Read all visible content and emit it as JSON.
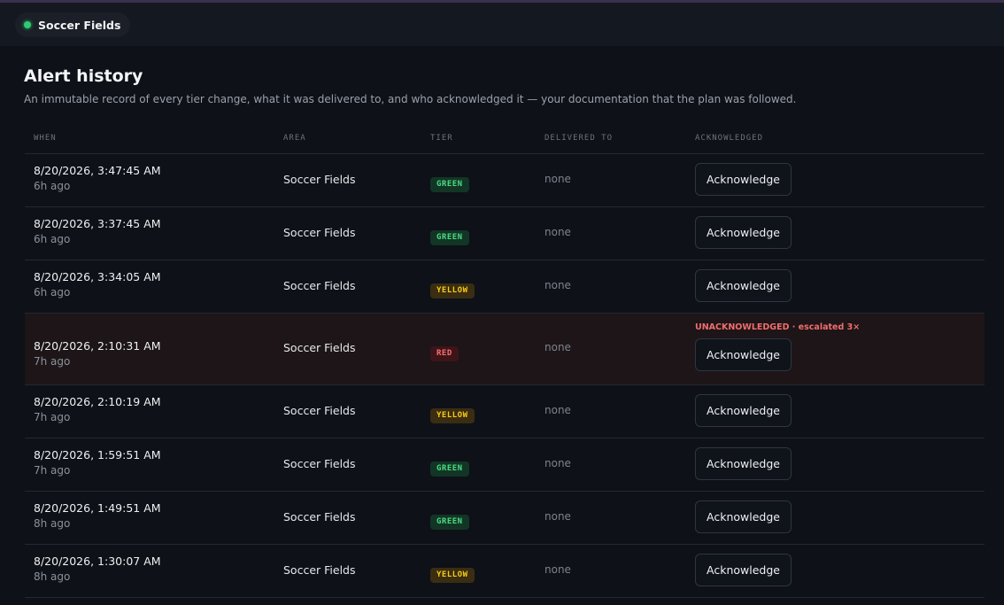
{
  "header": {
    "area_name": "Soccer Fields",
    "status_color": "#2ecc71"
  },
  "page": {
    "title": "Alert history",
    "subtitle": "An immutable record of every tier change, what it was delivered to, and who acknowledged it — your documentation that the plan was followed."
  },
  "table": {
    "columns": [
      "WHEN",
      "AREA",
      "TIER",
      "DELIVERED TO",
      "ACKNOWLEDGED"
    ],
    "ack_label": "Acknowledge",
    "rows": [
      {
        "when": "8/20/2026, 3:47:45 AM",
        "ago": "6h ago",
        "area": "Soccer Fields",
        "tier": "GREEN",
        "delivered": "none",
        "escalation": ""
      },
      {
        "when": "8/20/2026, 3:37:45 AM",
        "ago": "6h ago",
        "area": "Soccer Fields",
        "tier": "GREEN",
        "delivered": "none",
        "escalation": ""
      },
      {
        "when": "8/20/2026, 3:34:05 AM",
        "ago": "6h ago",
        "area": "Soccer Fields",
        "tier": "YELLOW",
        "delivered": "none",
        "escalation": ""
      },
      {
        "when": "8/20/2026, 2:10:31 AM",
        "ago": "7h ago",
        "area": "Soccer Fields",
        "tier": "RED",
        "delivered": "none",
        "escalation": "UNACKNOWLEDGED · escalated 3×"
      },
      {
        "when": "8/20/2026, 2:10:19 AM",
        "ago": "7h ago",
        "area": "Soccer Fields",
        "tier": "YELLOW",
        "delivered": "none",
        "escalation": ""
      },
      {
        "when": "8/20/2026, 1:59:51 AM",
        "ago": "7h ago",
        "area": "Soccer Fields",
        "tier": "GREEN",
        "delivered": "none",
        "escalation": ""
      },
      {
        "when": "8/20/2026, 1:49:51 AM",
        "ago": "8h ago",
        "area": "Soccer Fields",
        "tier": "GREEN",
        "delivered": "none",
        "escalation": ""
      },
      {
        "when": "8/20/2026, 1:30:07 AM",
        "ago": "8h ago",
        "area": "Soccer Fields",
        "tier": "YELLOW",
        "delivered": "none",
        "escalation": ""
      }
    ]
  }
}
